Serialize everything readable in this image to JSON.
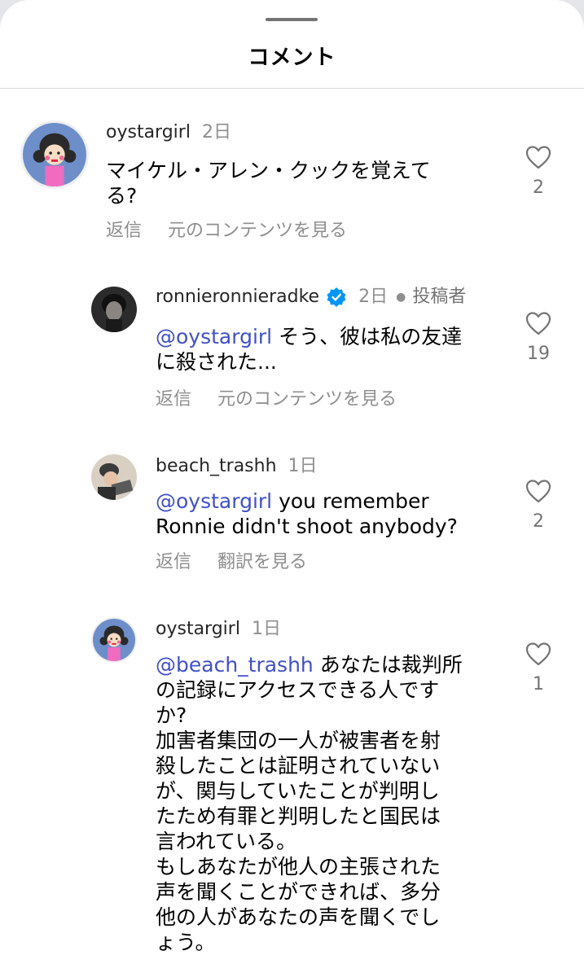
{
  "header": {
    "title": "コメント"
  },
  "comments": [
    {
      "username": "oystargirl",
      "time": "2日",
      "body": "マイケル・アレン・クックを覚えて\nる?",
      "actions": [
        "返信",
        "元のコンテンツを見る"
      ],
      "likes": "2",
      "avatar_icon": "cartoon-girl-avatar"
    },
    {
      "username": "ronnieronnieradke",
      "verified": true,
      "time": "2日",
      "badge": "投稿者",
      "mention": "@oystargirl",
      "body": " そう、彼は私の友達\nに殺された...",
      "actions": [
        "返信",
        "元のコンテンツを見る"
      ],
      "likes": "19",
      "avatar_icon": "profile-photo-avatar"
    },
    {
      "username": "beach_trashh",
      "time": "1日",
      "mention": "@oystargirl",
      "body": " you remember\nRonnie didn't shoot anybody?",
      "actions": [
        "返信",
        "翻訳を見る"
      ],
      "likes": "2",
      "avatar_icon": "profile-photo-avatar"
    },
    {
      "username": "oystargirl",
      "time": "1日",
      "mention": "@beach_trashh",
      "body": " あなたは裁判所\nの記録にアクセスできる人です\nか?\n加害者集団の一人が被害者を射\n殺したことは証明されていない\nが、関与していたことが判明し\nたため有罪と判明したと国民は\n言われている。\nもしあなたが他人の主張された\n声を聞くことができれば、多分\n他の人があなたの声を聞くでし\nょう。",
      "likes": "1",
      "avatar_icon": "cartoon-girl-avatar"
    }
  ],
  "colors": {
    "mention": "#4150c8",
    "verified": "#0095f6",
    "muted": "#8e8e8e",
    "avatar_bg": "#6d8ec9"
  }
}
